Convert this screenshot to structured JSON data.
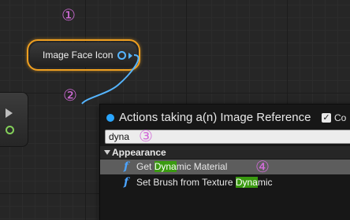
{
  "markers": [
    "①",
    "②",
    "③",
    "④"
  ],
  "node": {
    "label": "Image Face Icon",
    "border_color": "#f0a020",
    "pin_color": "#55b5ff"
  },
  "menu": {
    "title": "Actions taking a(n) Image Reference",
    "context_sensitive_label": "Co",
    "context_sensitive_checked": true,
    "search_value": "dyna",
    "category": "Appearance",
    "actions": [
      {
        "pre": "Get ",
        "match": "Dyna",
        "post": "mic Material",
        "selected": true,
        "icon": "function-icon"
      },
      {
        "pre": "Set Brush from Texture ",
        "match": "Dyna",
        "post": "mic",
        "selected": false,
        "icon": "function-icon"
      }
    ],
    "match_highlight_color": "#3a9a10",
    "accent_color": "#2aa6ff"
  }
}
